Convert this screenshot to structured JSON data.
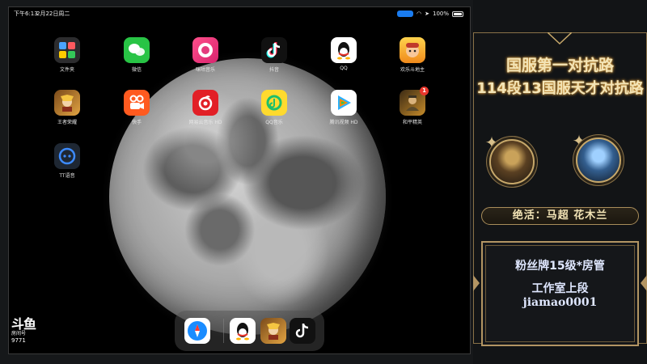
{
  "status_bar": {
    "time": "下午6:13",
    "date": "2月22日周二",
    "battery": "100%"
  },
  "apps": [
    {
      "name": "文件夹"
    },
    {
      "name": "微信"
    },
    {
      "name": "咪咕音乐"
    },
    {
      "name": "抖音"
    },
    {
      "name": "QQ"
    },
    {
      "name": "欢乐斗地主"
    },
    {
      "name": "王者荣耀"
    },
    {
      "name": "快手"
    },
    {
      "name": "网易云音乐 HD"
    },
    {
      "name": "QQ音乐"
    },
    {
      "name": "腾讯视频 HD"
    },
    {
      "name": "和平精英",
      "badge": "1"
    },
    {
      "name": "TT语音"
    }
  ],
  "dock": [
    "Safari",
    "QQ",
    "王者荣耀",
    "抖音"
  ],
  "watermark": {
    "logo": "斗鱼",
    "room_label": "房间号",
    "room_number": "9771"
  },
  "panel": {
    "title_line1": "国服第一对抗路",
    "title_line2": "114段13国服天才对抗路",
    "skill": "绝活：马超  花木兰",
    "fan_line": "粉丝牌15级*房管",
    "studio_line": "工作室上段",
    "account": "jiamao0001"
  },
  "colors": {
    "accent_gold": "#c7a86a",
    "title_glow": "#c98a30",
    "status_pill": "#1a7cf0"
  }
}
